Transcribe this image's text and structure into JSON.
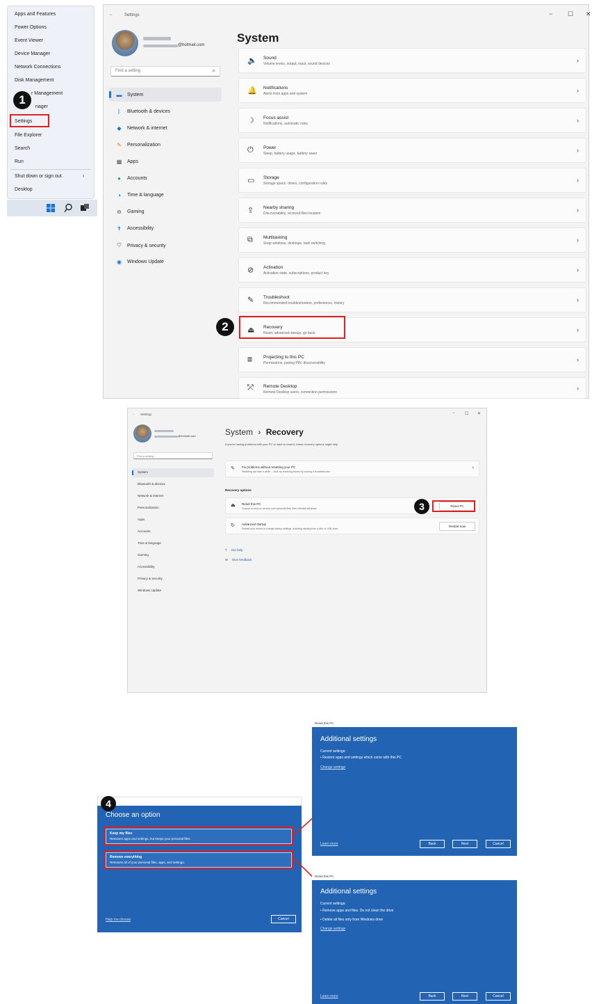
{
  "winx_menu": {
    "items": [
      "Apps and Features",
      "Power Options",
      "Event Viewer",
      "Device Manager",
      "Network Connections",
      "Disk Management",
      "Computer Management",
      "Task Manager",
      "Settings",
      "File Explorer",
      "Search",
      "Run",
      "Shut down or sign out",
      "Desktop"
    ],
    "visible_item_6": "r Management",
    "visible_item_7": "nager",
    "submenu_arrow": "›"
  },
  "badges": {
    "one": "1",
    "two": "2",
    "three": "3",
    "four": "4"
  },
  "settings": {
    "title": "Settings",
    "back": "←",
    "min": "−",
    "max": "☐",
    "close": "✕",
    "account_email": "@hotmail.com",
    "search_placeholder": "Find a setting",
    "search_icon": "⌕",
    "page_title": "System",
    "sidebar": [
      {
        "label": "System",
        "icon": "▬"
      },
      {
        "label": "Bluetooth & devices",
        "icon": "ᛒ"
      },
      {
        "label": "Network & internet",
        "icon": "◆"
      },
      {
        "label": "Personalization",
        "icon": "✎"
      },
      {
        "label": "Apps",
        "icon": "▦"
      },
      {
        "label": "Accounts",
        "icon": "●"
      },
      {
        "label": "Time & language",
        "icon": "◑"
      },
      {
        "label": "Gaming",
        "icon": "⊖"
      },
      {
        "label": "Accessibility",
        "icon": "✝"
      },
      {
        "label": "Privacy & security",
        "icon": "⛉"
      },
      {
        "label": "Windows Update",
        "icon": "◉"
      }
    ],
    "cards": [
      {
        "title": "Sound",
        "sub": "Volume levels, output, input, sound devices",
        "icon": "🔈"
      },
      {
        "title": "Notifications",
        "sub": "Alerts from apps and system",
        "icon": "🔔"
      },
      {
        "title": "Focus assist",
        "sub": "Notifications, automatic rules",
        "icon": "☽"
      },
      {
        "title": "Power",
        "sub": "Sleep, battery usage, battery saver",
        "icon": "⏻"
      },
      {
        "title": "Storage",
        "sub": "Storage space, drives, configuration rules",
        "icon": "▭"
      },
      {
        "title": "Nearby sharing",
        "sub": "Discoverability, received files location",
        "icon": "⇪"
      },
      {
        "title": "Multitasking",
        "sub": "Snap windows, desktops, task switching",
        "icon": "⧉"
      },
      {
        "title": "Activation",
        "sub": "Activation state, subscriptions, product key",
        "icon": "⊘"
      },
      {
        "title": "Troubleshoot",
        "sub": "Recommended troubleshooters, preferences, history",
        "icon": "✎"
      },
      {
        "title": "Recovery",
        "sub": "Reset, advanced startup, go back",
        "icon": "⏏"
      },
      {
        "title": "Projecting to this PC",
        "sub": "Permissions, pairing PIN, discoverability",
        "icon": "⧈"
      },
      {
        "title": "Remote Desktop",
        "sub": "Remote Desktop users, connection permissions",
        "icon": "⤱"
      }
    ],
    "chevron": "›"
  },
  "recovery": {
    "title": "Settings",
    "back": "←",
    "min": "−",
    "max": "☐",
    "close": "✕",
    "account_email": "@hotmail.com",
    "search_placeholder": "Find a setting",
    "breadcrumb_parent": "System",
    "breadcrumb_sep": "›",
    "breadcrumb_current": "Recovery",
    "intro": "If you're having problems with your PC or want to reset it, these recovery options might help",
    "fix_title": "Fix problems without resetting your PC",
    "fix_sub": "Resetting can take a while — first, try resolving issues by running a troubleshooter",
    "options_heading": "Recovery options",
    "reset_title": "Reset this PC",
    "reset_sub": "Choose to keep or remove your personal files, then reinstall Windows",
    "reset_btn": "Reset PC",
    "adv_title": "Advanced startup",
    "adv_sub": "Restart your device to change startup settings, including starting from a disc or USB drive",
    "adv_btn": "Restart now",
    "get_help": "Get help",
    "feedback": "Give feedback",
    "sidebar": [
      "System",
      "Bluetooth & devices",
      "Network & internet",
      "Personalization",
      "Apps",
      "Accounts",
      "Time & language",
      "Gaming",
      "Accessibility",
      "Privacy & security",
      "Windows Update"
    ]
  },
  "choose": {
    "heading": "Choose an option",
    "keep_title": "Keep my files",
    "keep_sub": "Removes apps and settings, but keeps your personal files.",
    "remove_title": "Remove everything",
    "remove_sub": "Removes all of your personal files, apps, and settings.",
    "help_link": "Help me choose",
    "cancel": "Cancel"
  },
  "additional_1": {
    "window_title": "Reset this PC",
    "heading": "Additional settings",
    "current": "Current settings:",
    "bullets": [
      "• Restore apps and settings which came with this PC"
    ],
    "change": "Change settings",
    "learn": "Learn more",
    "back": "Back",
    "next": "Next",
    "cancel": "Cancel"
  },
  "additional_2": {
    "window_title": "Reset this PC",
    "heading": "Additional settings",
    "current": "Current settings:",
    "bullets": [
      "• Remove apps and files. Do not clean the drive",
      "• Delete all files only from Windows drive"
    ],
    "change": "Change settings",
    "learn": "Learn more",
    "back": "Back",
    "next": "Next",
    "cancel": "Cancel"
  }
}
